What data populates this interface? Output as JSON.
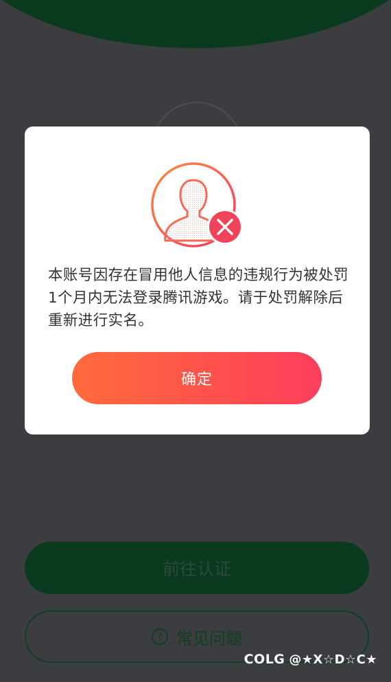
{
  "background": {
    "primary_button_label": "前往认证",
    "faq_button_label": "常见问题",
    "faq_icon_glyph": "?"
  },
  "dialog": {
    "icon": "user-blocked-icon",
    "message": "本账号因存在冒用他人信息的违规行为被处罚1个月内无法登录腾讯游戏。请于处罚解除后重新进行实名。",
    "confirm_label": "确定"
  },
  "watermark": {
    "brand": "COLG",
    "handle": "@★X☆D☆C★"
  },
  "colors": {
    "dim_background": "#3c3d40",
    "header_green": "#0a3a1e",
    "gradient_start": "#ff6b3a",
    "gradient_end": "#fd3e5c",
    "error_red": "#f0435a"
  }
}
